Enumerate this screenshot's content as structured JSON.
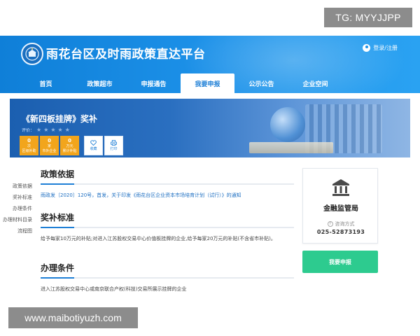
{
  "watermarks": {
    "top_right": "TG: MYYJJPP",
    "bottom_left": "www.maibotiyuzh.com"
  },
  "header": {
    "site_title": "雨花台区及时雨政策直达平台",
    "login_label": "登录/注册",
    "background_color": "#1e93ea"
  },
  "nav": {
    "items": [
      {
        "label": "首页"
      },
      {
        "label": "政策超市"
      },
      {
        "label": "申报通告"
      },
      {
        "label": "我要申报",
        "active": true
      },
      {
        "label": "公示公告"
      },
      {
        "label": "企业空间"
      }
    ]
  },
  "banner": {
    "title": "《新四板挂牌》奖补",
    "rating_label": "评价：",
    "rating_stars": 5,
    "stats": [
      {
        "value": "0",
        "unit": "次",
        "label": "区级补助"
      },
      {
        "value": "0",
        "unit": "家",
        "label": "市外企业"
      },
      {
        "value": "0",
        "unit": "万元",
        "label": "累计补贴"
      }
    ],
    "actions": [
      {
        "label": "收藏",
        "icon": "heart-icon"
      },
      {
        "label": "打印",
        "icon": "print-icon"
      }
    ],
    "stat_color": "#f2a51c"
  },
  "side_nav": {
    "items": [
      "政策依据",
      "奖补标准",
      "办理条件",
      "办理材料目录",
      "流程图"
    ]
  },
  "sections": {
    "basis": {
      "title": "政策依据",
      "link": "雨政发〔2020〕120号，首发，关于印发《雨花台区企业资本市场培育计划（试行）》的通知"
    },
    "standard": {
      "title": "奖补标准",
      "text": "给予每家10万元的补贴;对进入江苏股权交易中心价值板挂牌的企业,给予每家20万元的补贴(不含省市补贴)。"
    },
    "conditions": {
      "title": "办理条件",
      "text": "进入江苏股权交易中心或南京联合产权(科技)交易所展示挂牌的企业"
    }
  },
  "dept_card": {
    "icon": "bank-icon",
    "name": "金融监管局",
    "contact_label": "咨询方式",
    "phone": "025-52873193"
  },
  "apply_button": {
    "label": "我要申报",
    "color": "#2dcb8f"
  }
}
